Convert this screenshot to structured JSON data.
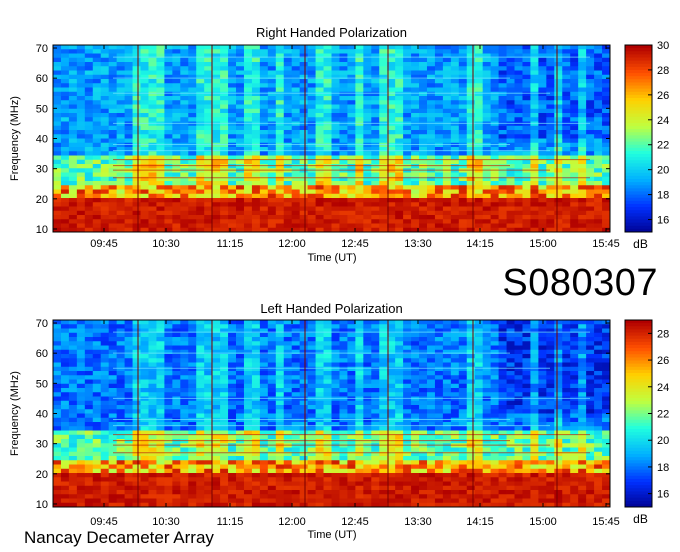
{
  "station": "Nancay Decameter Array",
  "obs_code": "S080307",
  "chart_data": [
    {
      "type": "heatmap",
      "title": "Right Handed Polarization",
      "xlabel": "Time (UT)",
      "ylabel": "Frequency (MHz)",
      "x_ticks": [
        "09:45",
        "10:30",
        "11:15",
        "12:00",
        "12:45",
        "13:30",
        "14:15",
        "15:00",
        "15:45"
      ],
      "y_ticks": [
        10,
        20,
        30,
        40,
        50,
        60,
        70
      ],
      "ylim": [
        9,
        71
      ],
      "colorbar": {
        "label": "dB",
        "ticks": [
          16,
          18,
          20,
          22,
          24,
          26,
          28,
          30
        ],
        "range": [
          15,
          30
        ]
      },
      "colormap": [
        "#00008f",
        "#0030ff",
        "#00b0ff",
        "#20ffdf",
        "#bfff40",
        "#ffd000",
        "#ff5000",
        "#b00000"
      ]
    },
    {
      "type": "heatmap",
      "title": "Left Handed Polarization",
      "xlabel": "Time (UT)",
      "ylabel": "Frequency (MHz)",
      "x_ticks": [
        "09:45",
        "10:30",
        "11:15",
        "12:00",
        "12:45",
        "13:30",
        "14:15",
        "15:00",
        "15:45"
      ],
      "y_ticks": [
        10,
        20,
        30,
        40,
        50,
        60,
        70
      ],
      "ylim": [
        9,
        71
      ],
      "colorbar": {
        "label": "dB",
        "ticks": [
          16,
          18,
          20,
          22,
          24,
          26,
          28
        ],
        "range": [
          15,
          29
        ]
      },
      "colormap": [
        "#00008f",
        "#0030ff",
        "#00b0ff",
        "#20ffdf",
        "#bfff40",
        "#ffd000",
        "#ff5000",
        "#b00000"
      ]
    }
  ]
}
